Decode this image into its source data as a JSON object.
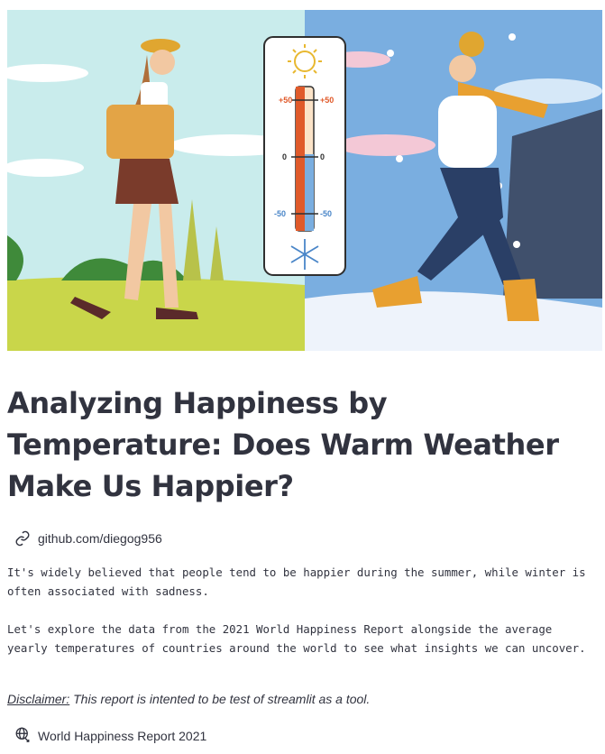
{
  "hero": {
    "image": "summer-winter-thermometer-illustration",
    "thermo_labels": {
      "top": "+50",
      "mid": "0",
      "bottom": "-50"
    }
  },
  "title": "Analyzing Happiness by Temperature: Does Warm Weather Make Us Happier?",
  "github_link": {
    "icon": "link-icon",
    "text": "github.com/diegog956"
  },
  "paragraphs": {
    "p1": "It's widely believed that people tend to be happier during the summer, while winter is often associated with sadness.",
    "p2": "Let's explore the data from the 2021 World Happiness Report alongside the average yearly temperatures of countries around the world to see what insights we can uncover."
  },
  "disclaimer": {
    "label": "Disclaimer:",
    "text": " This report is intented to be test of streamlit as a tool."
  },
  "report_link": {
    "icon": "globe-link-icon",
    "text": "World Happiness Report 2021"
  }
}
